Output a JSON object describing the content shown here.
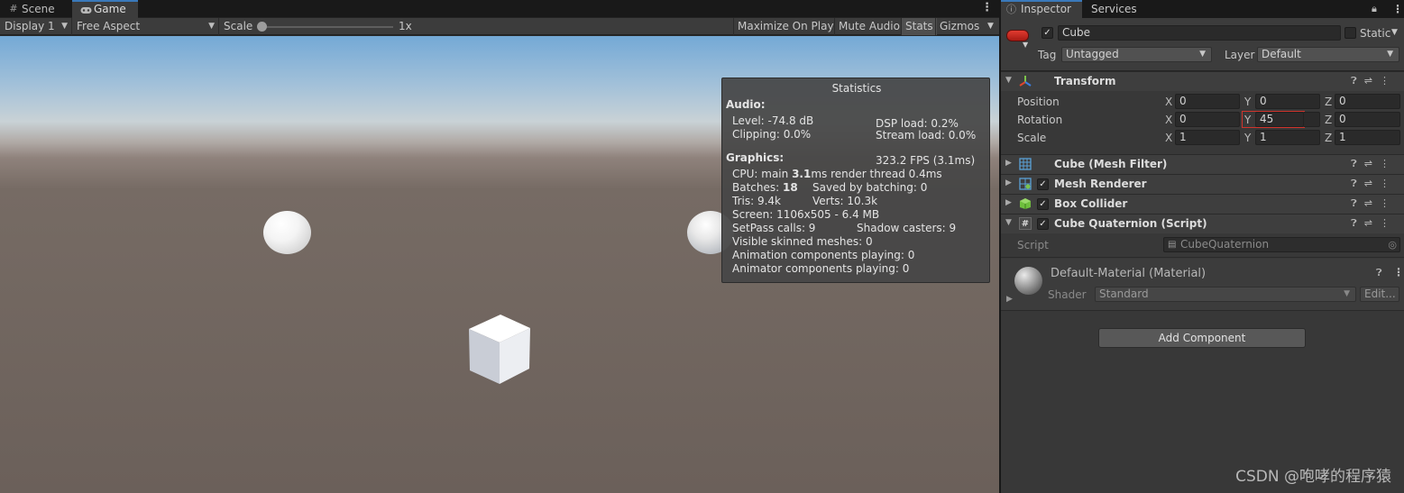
{
  "game_tabs": [
    {
      "label": "Scene",
      "icon": "grid-icon"
    },
    {
      "label": "Game",
      "icon": "gamepad-icon"
    }
  ],
  "toolbar": {
    "display": "Display 1",
    "aspect": "Free Aspect",
    "scale_label": "Scale",
    "scale_value": "1x",
    "maximize_on_play": "Maximize On Play",
    "mute_audio": "Mute Audio",
    "stats": "Stats",
    "gizmos": "Gizmos"
  },
  "stats": {
    "title": "Statistics",
    "audio_header": "Audio:",
    "level": "Level: -74.8 dB",
    "dsp_load": "DSP load: 0.2%",
    "clipping": "Clipping: 0.0%",
    "stream_load": "Stream load: 0.0%",
    "graphics_header": "Graphics:",
    "fps": "323.2 FPS (3.1ms)",
    "cpu_prefix": "CPU: main ",
    "cpu_main": "3.1",
    "cpu_suffix": "ms  render thread 0.4ms",
    "batches_prefix": "Batches: ",
    "batches": "18",
    "saved_by_batching": "Saved by batching: 0",
    "tris": "Tris: 9.4k",
    "verts": "Verts: 10.3k",
    "screen": "Screen: 1106x505 - 6.4 MB",
    "setpass": "SetPass calls: 9",
    "shadow_casters": "Shadow casters: 9",
    "skinned": "Visible skinned meshes: 0",
    "animation": "Animation components playing: 0",
    "animator": "Animator components playing: 0"
  },
  "inspector_tabs": [
    {
      "label": "Inspector",
      "icon": "info-icon"
    },
    {
      "label": "Services"
    }
  ],
  "object": {
    "name": "Cube",
    "static_label": "Static",
    "tag_label": "Tag",
    "tag": "Untagged",
    "layer_label": "Layer",
    "layer": "Default"
  },
  "transform": {
    "title": "Transform",
    "position_label": "Position",
    "rotation_label": "Rotation",
    "scale_label": "Scale",
    "axes": [
      "X",
      "Y",
      "Z"
    ],
    "position": [
      "0",
      "0",
      "0"
    ],
    "rotation": [
      "0",
      "45",
      "0"
    ],
    "scale": [
      "1",
      "1",
      "1"
    ]
  },
  "components": [
    {
      "name": "Cube (Mesh Filter)",
      "icon": "mesh-filter-icon"
    },
    {
      "name": "Mesh Renderer",
      "icon": "mesh-renderer-icon"
    },
    {
      "name": "Box Collider",
      "icon": "box-collider-icon"
    },
    {
      "name": "Cube Quaternion (Script)",
      "icon": "script-icon"
    }
  ],
  "script": {
    "label": "Script",
    "value": "CubeQuaternion"
  },
  "material": {
    "name": "Default-Material (Material)",
    "shader_label": "Shader",
    "shader": "Standard",
    "edit": "Edit..."
  },
  "add_component": "Add Component",
  "watermark": "CSDN @咆哮的程序猿",
  "colors": {
    "accent_tab": "#3a79bb",
    "highlight_border": "#d0342c",
    "inspector_bg": "#383838"
  }
}
